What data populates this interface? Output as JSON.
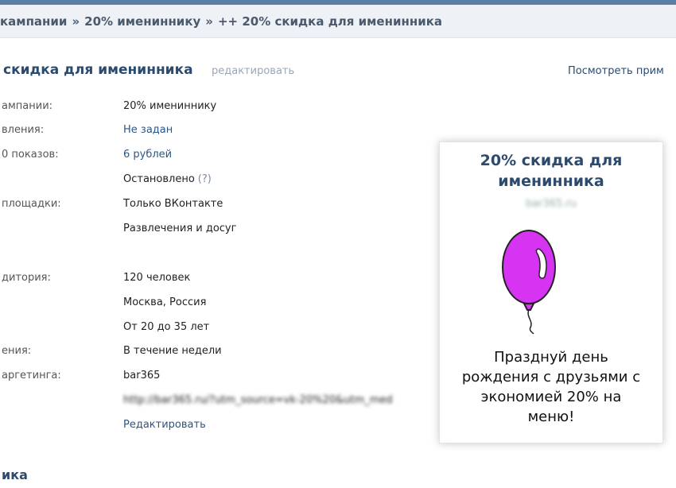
{
  "breadcrumb": {
    "part1": "кампании",
    "sep1": "»",
    "part2": "20% имениннику",
    "sep2": "»",
    "part3": "++ 20% скидка для именинника"
  },
  "header": {
    "title": "скидка для именинника",
    "edit": "редактировать",
    "preview": "Посмотреть прим"
  },
  "details": {
    "rows": [
      {
        "label": "ампании:",
        "value": "20% имениннику"
      },
      {
        "label": "вления:",
        "value": "Не задан"
      },
      {
        "label": "0 показов:",
        "value": "6 рублей"
      },
      {
        "label": "",
        "value": "Остановлено",
        "hint": "(?)"
      },
      {
        "label": "площадки:",
        "value": "Только ВКонтакте"
      },
      {
        "label": "",
        "value": "Развлечения и досуг"
      },
      {
        "label": "дитория:",
        "value": "120 человек"
      },
      {
        "label": "",
        "value": "Москва, Россия"
      },
      {
        "label": "",
        "value": "От 20 до 35 лет"
      },
      {
        "label": "ения:",
        "value": "В течение недели"
      },
      {
        "label": "аргетинга:",
        "value": "bar365"
      },
      {
        "label": "",
        "value": "http://bar365.ru/?utm_source=vk-20%20&utm_med"
      },
      {
        "label": "",
        "value": "Редактировать"
      }
    ]
  },
  "section_bottom": "ика",
  "ad_preview": {
    "title": "20% скидка для именинника",
    "domain": "bar365.ru",
    "text": "Празднуй день рождения с друзьями с экономией 20% на меню!",
    "balloon_color": "#d633f2"
  }
}
